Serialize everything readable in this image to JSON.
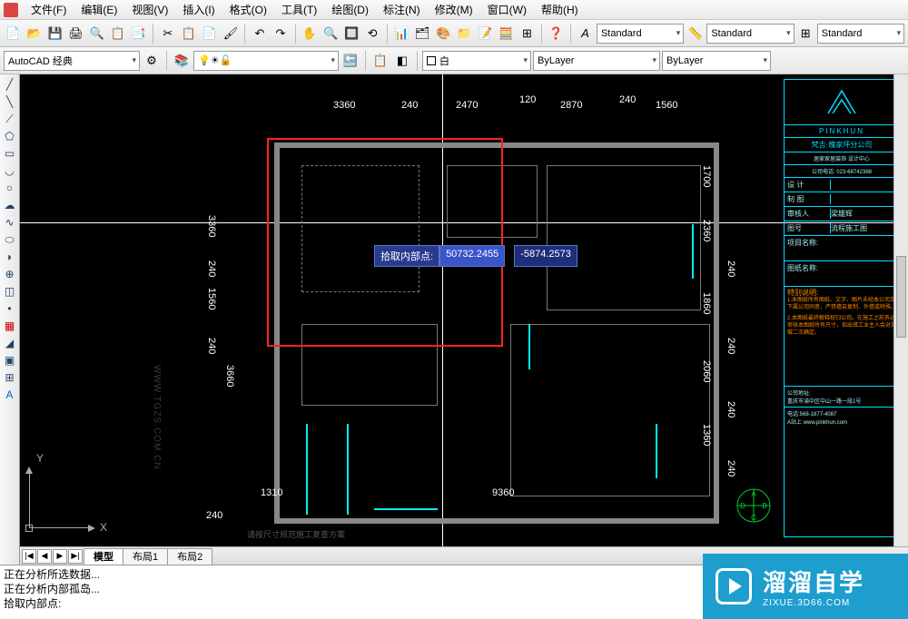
{
  "menus": [
    "文件(F)",
    "编辑(E)",
    "视图(V)",
    "插入(I)",
    "格式(O)",
    "工具(T)",
    "绘图(D)",
    "标注(N)",
    "修改(M)",
    "窗口(W)",
    "帮助(H)"
  ],
  "toolbar2": {
    "style_a_label": "Standard",
    "style_b_label": "Standard",
    "style_c_label": "Standard"
  },
  "workspace": {
    "name": "AutoCAD 经典",
    "layer_color_label": "白",
    "lineweight_label": "ByLayer",
    "linetype_label": "ByLayer"
  },
  "dims": {
    "top": [
      "3360",
      "240",
      "2470",
      "120",
      "2870",
      "240",
      "1560"
    ],
    "left": [
      "3360",
      "240",
      "1560",
      "240",
      "3660"
    ],
    "right_outer": [
      "1700",
      "2360",
      "1860",
      "2060",
      "1360"
    ],
    "right_inner": [
      "240",
      "240",
      "240",
      "240"
    ],
    "bottom": [
      "1310",
      "9360",
      "240"
    ]
  },
  "tooltip": {
    "label": "拾取内部点:",
    "val1": "50732.2455",
    "val2": "-5874.2573"
  },
  "ucs": {
    "x": "X",
    "y": "Y"
  },
  "titleblock": {
    "brand": "PINKHUN",
    "company": "梵吉·魄家坪分公司",
    "sub1": "居家家居装饰 设计中心",
    "sub2": "公司电话: 023-68742388",
    "r1a": "设 计",
    "r1b": "",
    "r2a": "制 图",
    "r2b": "",
    "r3a": "审核人",
    "r3b": "梁雄辉",
    "r4a": "图号",
    "r4b": "流程施工图",
    "proj_label": "项目名称:",
    "draw_label": "图纸名称:",
    "note_title": "特别说明:",
    "note1": "1.本图纸所有图纸、文字、图片未经本公司及下属公司同意，严禁擅自复制、外借或特殊。",
    "note2": "2.本图纸最终解释权归公司。在施工之前务必审核本图纸所有尺寸，如出错工业主人会对其做二次确定。",
    "addr_label": "公司地址:",
    "addr": "重庆市渝中区中山一路一段1号",
    "tel_label": "电话:",
    "tel": "568-1877-4087",
    "url": "A站上 www.pinkhun.com"
  },
  "tabs": {
    "model": "模型",
    "layout1": "布局1",
    "layout2": "布局2"
  },
  "note_bottom": "请按尺寸规范施工复查方案",
  "watermark": "WWW.TGZS.COM.CN",
  "cmd": {
    "l1": "正在分析所选数据...",
    "l2": "正在分析内部孤岛...",
    "l3": "拾取内部点:"
  },
  "badge": {
    "cn": "溜溜自学",
    "en": "ZIXUE.3D66.COM"
  },
  "compass": {
    "a": "A",
    "b": "B",
    "c": "C",
    "d": "D"
  }
}
